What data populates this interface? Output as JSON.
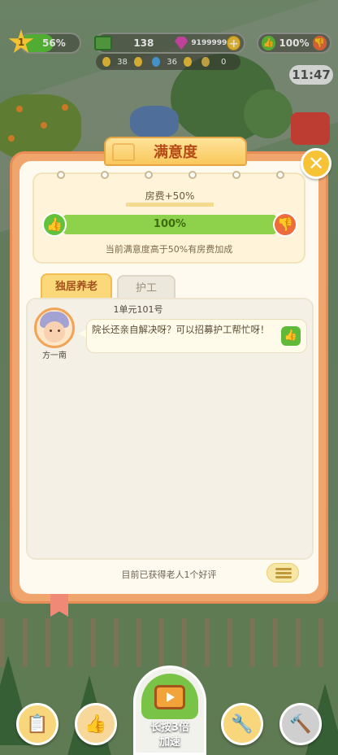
{
  "hud": {
    "level": "1",
    "level_progress_text": "56%",
    "level_progress": 0.56,
    "money": "138",
    "gems": "9199999",
    "approval": "100%",
    "power": "38",
    "water": "36",
    "bells": "0",
    "time": "11:47"
  },
  "dialog": {
    "title": "满意度",
    "fee_label": "房费+50%",
    "satisfaction_text": "100%",
    "satisfaction": 1.0,
    "note": "当前满意度高于50%有房费加成",
    "tabs": [
      {
        "label": "独居养老",
        "active": true
      },
      {
        "label": "护工",
        "active": false
      }
    ],
    "entries": [
      {
        "room": "1单元101号",
        "name": "方一南",
        "message": "院长还亲自解决呀？可以招募护工帮忙呀！"
      }
    ],
    "review_summary": "目前已获得老人1个好评"
  },
  "toolbar": {
    "speed_label_line1": "长按3倍",
    "speed_label_line2": "加速"
  },
  "colors": {
    "frame": "#f0a56d",
    "accent_green": "#8ed24b",
    "accent_red": "#ee6b3d",
    "title_text": "#b64a17"
  }
}
